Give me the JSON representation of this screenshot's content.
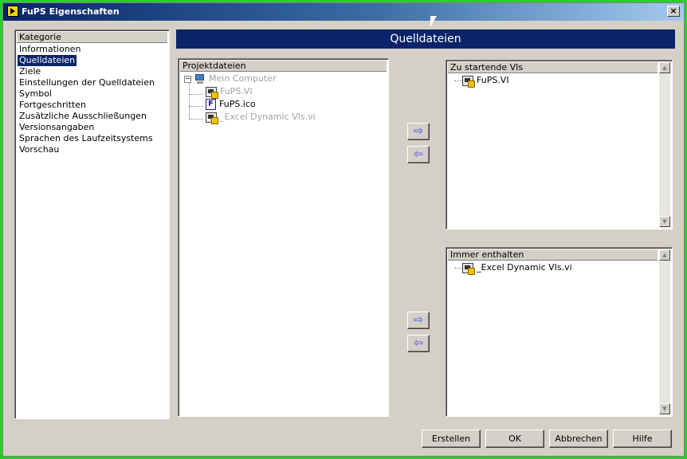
{
  "window": {
    "title": "FuPS Eigenschaften",
    "close_glyph": "×"
  },
  "category_panel": {
    "header": "Kategorie",
    "items": [
      "Informationen",
      "Quelldateien",
      "Ziele",
      "Einstellungen der Quelldateien",
      "Symbol",
      "Fortgeschritten",
      "Zusätzliche Ausschließungen",
      "Versionsangaben",
      "Sprachen des Laufzeitsystems",
      "Vorschau"
    ],
    "selected_index": 1
  },
  "section_title": "Quelldateien",
  "project_files": {
    "header": "Projektdateien",
    "expander": "−",
    "root": {
      "label": "Mein Computer",
      "icon": "computer-icon"
    },
    "children": [
      {
        "label": "FuPS.VI",
        "icon": "vi-icon",
        "dimmed": true
      },
      {
        "label": "FuPS.ico",
        "icon": "file-f-icon",
        "dimmed": false
      },
      {
        "label": "_Excel Dynamic VIs.vi",
        "icon": "vi-icon",
        "dimmed": true
      }
    ]
  },
  "startup_vis": {
    "header": "Zu startende VIs",
    "items": [
      {
        "label": "FuPS.VI",
        "icon": "vi-icon"
      }
    ]
  },
  "always_included": {
    "header": "Immer enthalten",
    "items": [
      {
        "label": "_Excel Dynamic VIs.vi",
        "icon": "vi-icon"
      }
    ]
  },
  "arrows": {
    "add": "⇨",
    "remove": "⇦"
  },
  "scroll": {
    "up": "▲",
    "down": "▼"
  },
  "buttons": {
    "build": "Erstellen",
    "ok": "OK",
    "cancel": "Abbrechen",
    "help": "Hilfe"
  },
  "colors": {
    "title_gradient_start": "#0a246a",
    "title_gradient_end": "#a6caf0",
    "selection": "#0a246a",
    "dialog_face": "#d4d0c8",
    "arrow": "#6a78d8"
  }
}
